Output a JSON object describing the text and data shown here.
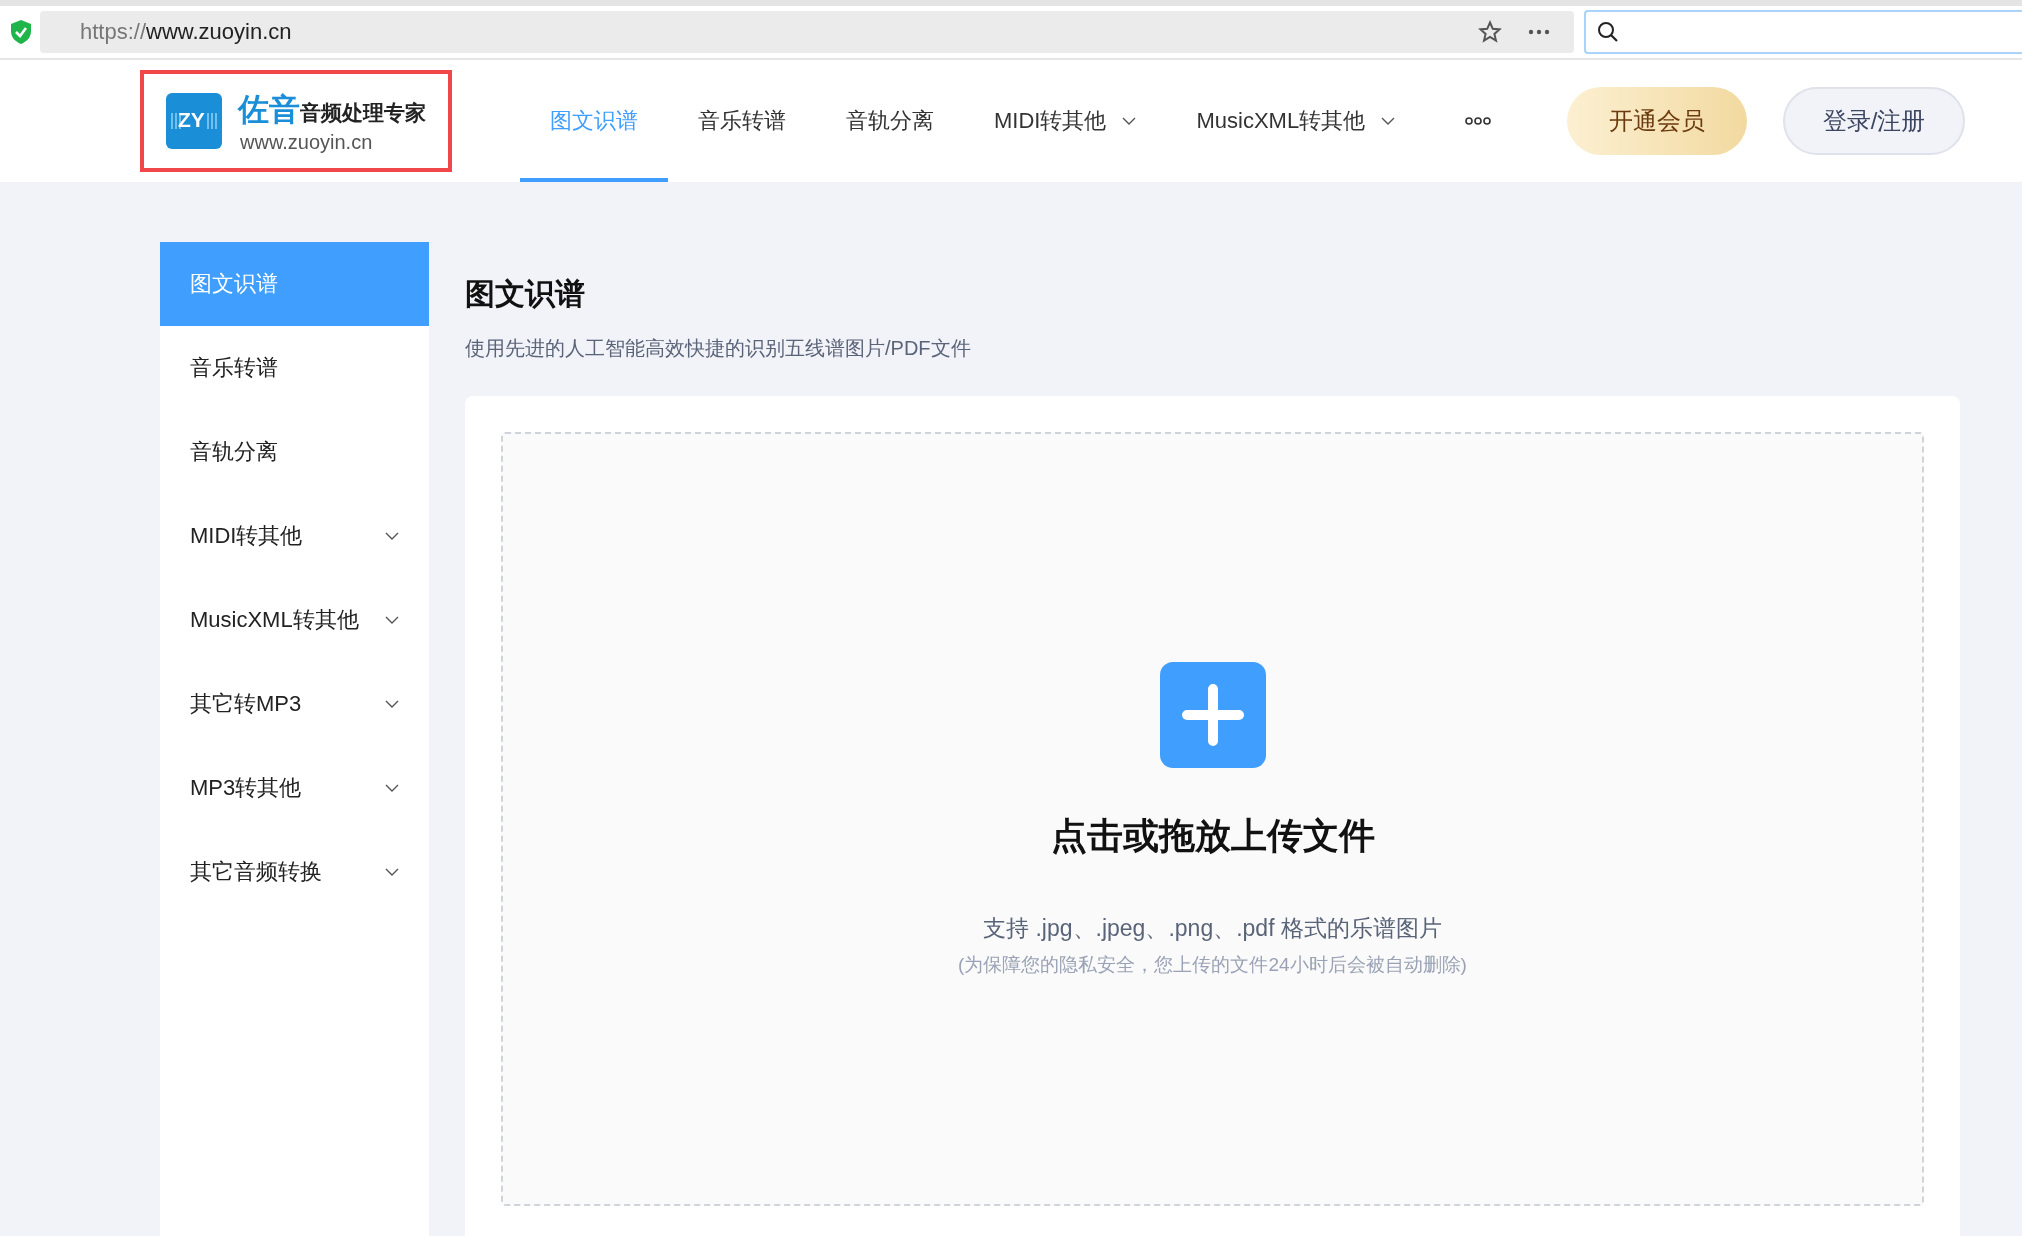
{
  "browser": {
    "url_prefix": "https://",
    "url_host": "www.zuoyin.cn"
  },
  "logo": {
    "badge": "ZY",
    "name": "佐音",
    "tagline": "音频处理专家",
    "domain": "www.zuoyin.cn"
  },
  "nav": [
    {
      "label": "图文识谱",
      "selected": true,
      "dropdown": false
    },
    {
      "label": "音乐转谱",
      "selected": false,
      "dropdown": false
    },
    {
      "label": "音轨分离",
      "selected": false,
      "dropdown": false
    },
    {
      "label": "MIDI转其他",
      "selected": false,
      "dropdown": true
    },
    {
      "label": "MusicXML转其他",
      "selected": false,
      "dropdown": true
    }
  ],
  "header_buttons": [
    {
      "label": "开通会员",
      "kind": "vip"
    },
    {
      "label": "登录/注册",
      "kind": "login"
    }
  ],
  "sidebar": [
    {
      "label": "图文识谱",
      "selected": true,
      "expandable": false
    },
    {
      "label": "音乐转谱",
      "selected": false,
      "expandable": false
    },
    {
      "label": "音轨分离",
      "selected": false,
      "expandable": false
    },
    {
      "label": "MIDI转其他",
      "selected": false,
      "expandable": true
    },
    {
      "label": "MusicXML转其他",
      "selected": false,
      "expandable": true
    },
    {
      "label": "其它转MP3",
      "selected": false,
      "expandable": true
    },
    {
      "label": "MP3转其他",
      "selected": false,
      "expandable": true
    },
    {
      "label": "其它音频转换",
      "selected": false,
      "expandable": true
    }
  ],
  "main": {
    "title": "图文识谱",
    "subtitle": "使用先进的人工智能高效快捷的识别五线谱图片/PDF文件",
    "upload": {
      "title": "点击或拖放上传文件",
      "formats": "支持 .jpg、.jpeg、.png、.pdf 格式的乐谱图片",
      "note": "(为保障您的隐私安全，您上传的文件24小时后会被自动删除)"
    }
  }
}
